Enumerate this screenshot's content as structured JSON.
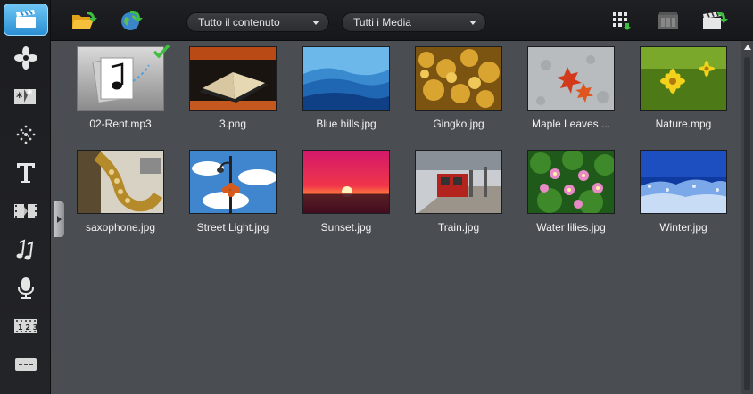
{
  "toolbar": {
    "filter_content": "Tutto il contenuto",
    "filter_media": "Tutti i Media",
    "left_icons": [
      "folder-open-icon",
      "import-globe-icon"
    ],
    "right_icons": [
      "grid-view-icon",
      "storyboard-icon",
      "export-clapper-icon"
    ]
  },
  "sidebar": {
    "items": [
      {
        "name": "media-library",
        "icon": "clapperboard-icon",
        "active": true
      },
      {
        "name": "transitions",
        "icon": "transition-icon",
        "active": false
      },
      {
        "name": "effects",
        "icon": "fx-icon",
        "active": false
      },
      {
        "name": "graphics",
        "icon": "sparkle-icon",
        "active": false
      },
      {
        "name": "title",
        "icon": "title-t-icon",
        "active": false
      },
      {
        "name": "instant-project",
        "icon": "film-strip-icon",
        "active": false
      },
      {
        "name": "music",
        "icon": "music-note-icon",
        "active": false
      },
      {
        "name": "voice",
        "icon": "microphone-icon",
        "active": false
      },
      {
        "name": "chapters",
        "icon": "numbered-strip-icon",
        "active": false
      },
      {
        "name": "subtitles",
        "icon": "subtitle-icon",
        "active": false
      }
    ]
  },
  "media_items": [
    {
      "label": "02-Rent.mp3",
      "kind": "audio",
      "checked": true
    },
    {
      "label": "3.png",
      "kind": "image"
    },
    {
      "label": "Blue hills.jpg",
      "kind": "image"
    },
    {
      "label": "Gingko.jpg",
      "kind": "image"
    },
    {
      "label": "Maple Leaves ...",
      "kind": "image"
    },
    {
      "label": "Nature.mpg",
      "kind": "video"
    },
    {
      "label": "saxophone.jpg",
      "kind": "image"
    },
    {
      "label": "Street Light.jpg",
      "kind": "image"
    },
    {
      "label": "Sunset.jpg",
      "kind": "image"
    },
    {
      "label": "Train.jpg",
      "kind": "image"
    },
    {
      "label": "Water lilies.jpg",
      "kind": "image"
    },
    {
      "label": "Winter.jpg",
      "kind": "image"
    }
  ],
  "colors": {
    "accent": "#2b8fd3",
    "background": "#4a4d52",
    "check": "#3fbf3f"
  }
}
